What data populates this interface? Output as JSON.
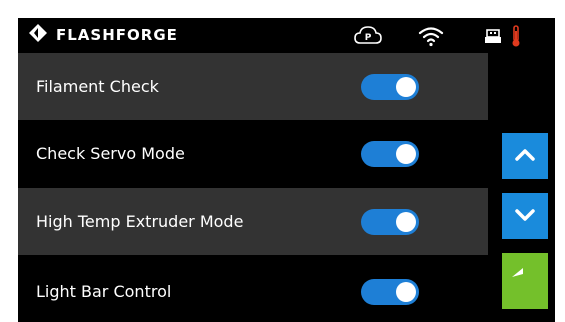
{
  "header": {
    "brand": "FLASHFORGE",
    "icons": [
      "flashforge-logo-icon",
      "cloud-p-icon",
      "wifi-icon",
      "usb-icon",
      "thermometer-icon"
    ],
    "cloud_letter": "P"
  },
  "settings": [
    {
      "label": "Filament Check",
      "enabled": true
    },
    {
      "label": "Check Servo Mode",
      "enabled": true
    },
    {
      "label": "High Temp Extruder Mode",
      "enabled": true
    },
    {
      "label": "Light Bar Control",
      "enabled": true
    }
  ],
  "nav": {
    "up_icon": "chevron-up-icon",
    "down_icon": "chevron-down-icon",
    "back_icon": "return-arrow-icon"
  },
  "colors": {
    "toggle_on": "#1e7fd6",
    "nav_blue": "#1a8bdc",
    "nav_green": "#74c02b",
    "row_shaded": "#333333",
    "thermometer": "#e03a1e"
  }
}
